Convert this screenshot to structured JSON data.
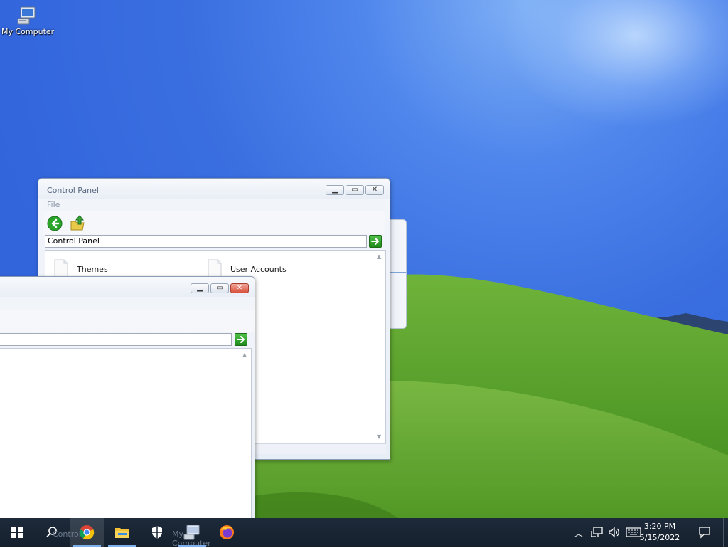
{
  "desktop": {
    "icons": [
      {
        "label": "My Computer"
      }
    ]
  },
  "windows": {
    "control_panel": {
      "title": "Control Panel",
      "menu": [
        "File"
      ],
      "address_value": "Control Panel",
      "items": [
        {
          "label": "Themes"
        },
        {
          "label": "User Accounts"
        }
      ]
    },
    "front_window": {
      "title": "",
      "address_value": ""
    }
  },
  "taskbar": {
    "buttons": [
      {
        "name": "start",
        "icon": "windows-logo-icon"
      },
      {
        "name": "search",
        "icon": "search-icon"
      },
      {
        "name": "chrome",
        "icon": "chrome-icon",
        "label": "Control"
      },
      {
        "name": "file-explorer",
        "icon": "folder-icon"
      },
      {
        "name": "security",
        "icon": "shield-icon"
      },
      {
        "name": "my-computer",
        "icon": "computer-icon",
        "label": "My Computer"
      },
      {
        "name": "firefox",
        "icon": "firefox-icon"
      }
    ],
    "clock": {
      "time": "3:20 PM",
      "date": "5/15/2022"
    }
  },
  "colors": {
    "sky": "#3a6fe0",
    "grass": "#5aa02c",
    "taskbar": "#1a2533",
    "go_button": "#2a9a24"
  }
}
